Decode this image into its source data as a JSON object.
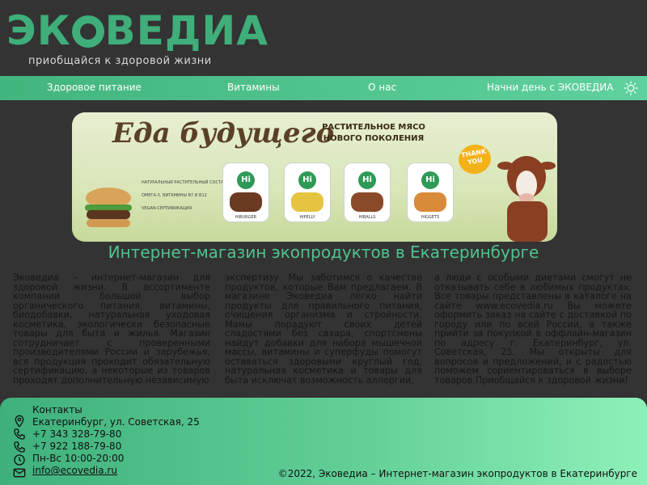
{
  "brand": {
    "logo_text": "ЭКОВЕДИА",
    "tagline": "приобщайся к здоровой жизни"
  },
  "nav": {
    "items": [
      "Здоровое питание",
      "Витамины",
      "О нас",
      "Начни день с ЭКОВЕДИА"
    ],
    "theme_icon": "sun-icon"
  },
  "banner": {
    "headline": "Еда будущего",
    "subheadline": "РАСТИТЕЛЬНОЕ МЯСО НОВОГО ПОКОЛЕНИЯ",
    "features": [
      "НАТУРАЛЬНЫЙ РАСТИТЕЛЬНЫЙ СОСТАВ",
      "ОМЕГА-3, ВИТАМИНЫ В7 И В12",
      "VEGAN-СЕРТИФИКАЦИЯ"
    ],
    "products": [
      "HIBURGER",
      "HIPELLY",
      "HIBALLS",
      "HIGGETS"
    ],
    "pack_brand": "Hi",
    "thank_you": "THANK YOU"
  },
  "main": {
    "title": "Интернет-магазин экопродуктов в Екатеринбурге",
    "columns": [
      "Эковедиа – интернет-магазин для здоровой жизни. В ассортименте компании большой выбор органического питания, витамины, биодобавки, натуральная уходовая косметика, экологически безопасные товары для быта и жилья. Магазин сотрудничает с проверенными производителями России и зарубежья, вся продукция проходит обязательную сертификацию, а некоторые из товаров проходят дополнительную независимую",
      "экспертизу. Мы заботимся о качестве продуктов, которые Вам предлагаем. В магазине Эковедиа легко найти продукты для правильного питания, очищения организма и стройности. Мамы порадуют своих детей сладостями без сахара, спортсмены найдут добавки для набора мышечной массы, витамины и суперфуды помогут оставаться здоровыми круглый год, натуральная косметика и товары для быта исключат возможность аллергии,",
      "а люди с особыми диетами смогут не отказывать себе в любимых продуктах. Все товары представлены в каталоге на сайте www.ecovedia.ru Вы можете оформить заказ на сайте с доставкой по городу или по всей России, а также прийти за покупкой в оффлайн-магазин по адресу г. Екатеринбург, ул. Советская, 25. Мы открыты для вопросов и предложений, и с радостью поможем сориентироваться в выборе товаров.Приобщайся к здоровой жизни!"
    ]
  },
  "footer": {
    "contacts_label": "Контакты",
    "address": "Екатеринбург, ул. Советская, 25",
    "phone1": "+7 343 328-79-80",
    "phone2": "+7 922 188-79-80",
    "hours": "Пн-Вс 10:00-20:00",
    "email": "info@ecovedia.ru",
    "copyright": "©2022, Эковедиа – Интернет-магазин экопродуктов в Екатеринбурге"
  },
  "colors": {
    "background": "#333333",
    "accent_green": "#4fc48d",
    "footer_gradient_end": "#8ef0b9"
  }
}
